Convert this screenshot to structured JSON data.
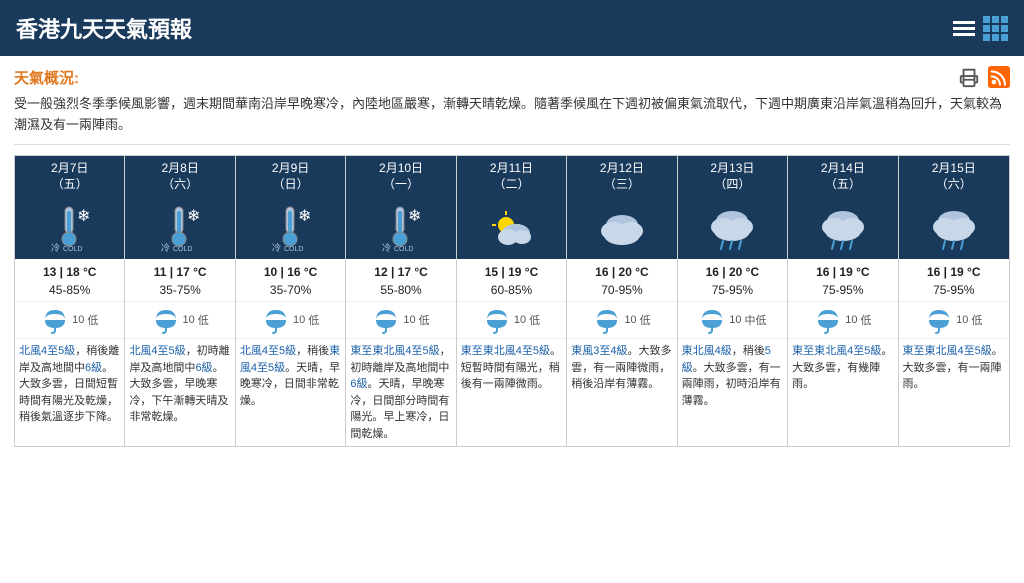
{
  "header": {
    "title": "香港九天天氣預報",
    "bars_icon": "menu-icon",
    "grid_icon": "grid-icon"
  },
  "overview": {
    "label": "天氣概況:",
    "text": "受一般強烈冬季季候風影響，週末期間華南沿岸早晚寒冷，內陸地區嚴寒，漸轉天晴乾燥。隨著季候風在下週初被偏東氣流取代，下週中期廣東沿岸氣溫稍為回升，天氣較為潮濕及有一兩陣雨。"
  },
  "days": [
    {
      "date": "2月7日",
      "weekday": "（五）",
      "icon": "thermometer-cold",
      "icon_label": "冷",
      "temp": "13 | 18 °C",
      "humidity": "45-85%",
      "uv": "低",
      "uv_num": "10",
      "wind": "北風4至5級，稍後離岸及高地間中6級。大致多雲，日間短暫時間有陽光及乾燥，稍後氣溫逐步下降。",
      "wind_links": [
        "北風4至5級",
        "6級"
      ]
    },
    {
      "date": "2月8日",
      "weekday": "（六）",
      "icon": "thermometer-cold",
      "icon_label": "冷",
      "temp": "11 | 17 °C",
      "humidity": "35-75%",
      "uv": "低",
      "uv_num": "10",
      "wind": "北風4至5級，初時離岸及高地間中6級。大致多雲，早晚寒冷，下午漸轉天晴及非常乾燥。",
      "wind_links": [
        "北風4至5級",
        "6級"
      ]
    },
    {
      "date": "2月9日",
      "weekday": "（日）",
      "icon": "thermometer-cold",
      "icon_label": "冷",
      "temp": "10 | 16 °C",
      "humidity": "35-70%",
      "uv": "低",
      "uv_num": "10",
      "wind": "北風4至5級，稍後東風4至5級。天晴，早晚寒冷，日間非常乾燥。",
      "wind_links": [
        "北風4至5級",
        "東風4至5級"
      ]
    },
    {
      "date": "2月10日",
      "weekday": "（一）",
      "icon": "thermometer-cold",
      "icon_label": "冷",
      "temp": "12 | 17 °C",
      "humidity": "55-80%",
      "uv": "低",
      "uv_num": "10",
      "wind": "東至東北風4至5級，初時離岸及高地間中6級。天晴，早晚寒冷，日間部分時間有陽光。早上寒冷，日間乾燥。",
      "wind_links": [
        "東至東北風4至5級",
        "6級"
      ]
    },
    {
      "date": "2月11日",
      "weekday": "（二）",
      "icon": "partly-cloudy",
      "icon_label": "",
      "temp": "15 | 19 °C",
      "humidity": "60-85%",
      "uv": "低",
      "uv_num": "10",
      "wind": "東至東北風4至5級。短暫時間有陽光，稍後有一兩陣微雨。",
      "wind_links": [
        "東至東北風4至5級"
      ]
    },
    {
      "date": "2月12日",
      "weekday": "（三）",
      "icon": "cloudy",
      "icon_label": "",
      "temp": "16 | 20 °C",
      "humidity": "70-95%",
      "uv": "低",
      "uv_num": "10",
      "wind": "東風3至4級。大致多雲，有一兩陣微雨，稍後沿岸有薄霧。",
      "wind_links": [
        "東風3至4級"
      ]
    },
    {
      "date": "2月13日",
      "weekday": "（四）",
      "icon": "cloudy-rain",
      "icon_label": "",
      "temp": "16 | 20 °C",
      "humidity": "75-95%",
      "uv": "中低",
      "uv_num": "10",
      "wind": "東北風4級，稍後5級。大致多雲，有一兩陣雨，初時沿岸有薄霧。",
      "wind_links": [
        "東北風4級",
        "5級"
      ]
    },
    {
      "date": "2月14日",
      "weekday": "（五）",
      "icon": "cloudy-rain",
      "icon_label": "",
      "temp": "16 | 19 °C",
      "humidity": "75-95%",
      "uv": "低",
      "uv_num": "10",
      "wind": "東至東北風4至5級。大致多雲，有幾陣雨。",
      "wind_links": [
        "東至東北風4至5級"
      ]
    },
    {
      "date": "2月15日",
      "weekday": "（六）",
      "icon": "cloudy-rain",
      "icon_label": "",
      "temp": "16 | 19 °C",
      "humidity": "75-95%",
      "uv": "低",
      "uv_num": "10",
      "wind": "東至東北風4至5級。大致多雲，有一兩陣雨。",
      "wind_links": [
        "東至東北風4至5級"
      ]
    }
  ]
}
